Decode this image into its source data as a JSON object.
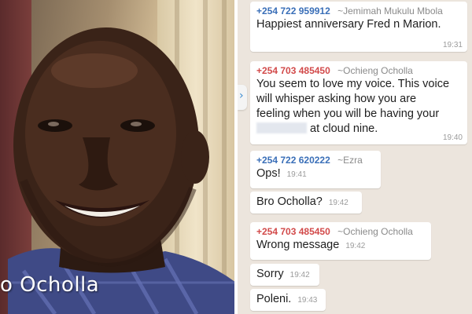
{
  "photo": {
    "caption": "o Ocholla"
  },
  "chat": {
    "messages": [
      {
        "sender_number": "+254 722 959912",
        "sender_alias": "~Jemimah Mukulu Mbola",
        "text": "Happiest anniversary Fred n Marion.",
        "time": "19:31",
        "color": "#3a6fb8"
      },
      {
        "sender_number": "+254 703 485450",
        "sender_alias": "~Ochieng Ocholla",
        "text_line1": "You seem to love my voice. This voice",
        "text_line2": "will whisper asking how you are",
        "text_line3": "feeling when you will be having your",
        "text_line4": "at cloud nine.",
        "time": "19:40",
        "color": "#d24a4a"
      },
      {
        "sender_number": "+254 722 620222",
        "sender_alias": "~Ezra",
        "text": "Ops!",
        "time": "19:41",
        "color": "#3a6fb8"
      },
      {
        "text": "Bro Ocholla?",
        "time": "19:42"
      },
      {
        "sender_number": "+254 703 485450",
        "sender_alias": "~Ochieng Ocholla",
        "text": "Wrong message",
        "time": "19:42",
        "color": "#d24a4a"
      },
      {
        "text": "Sorry",
        "time": "19:42"
      },
      {
        "text": "Poleni.",
        "time": "19:43"
      }
    ]
  }
}
